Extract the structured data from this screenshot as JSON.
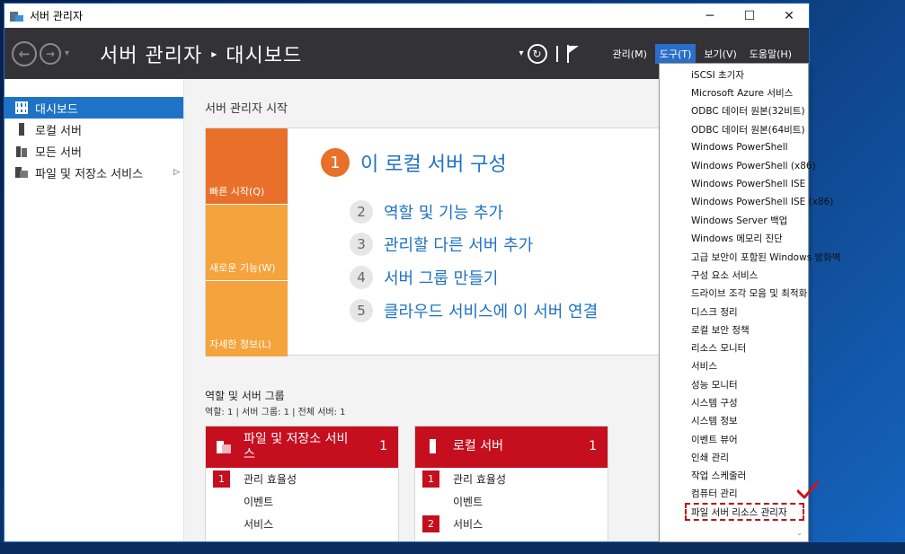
{
  "window": {
    "title": "서버 관리자",
    "controls": {
      "minimize": "─",
      "maximize": "☐",
      "close": "✕"
    }
  },
  "header": {
    "breadcrumb_root": "서버 관리자",
    "breadcrumb_sep": "▸",
    "breadcrumb_page": "대시보드",
    "refresh_drop": "▾",
    "menu": [
      "관리(M)",
      "도구(T)",
      "보기(V)",
      "도움말(H)"
    ],
    "active_menu": "도구(T)"
  },
  "sidebar": {
    "items": [
      {
        "label": "대시보드",
        "icon": "dashboard-icon",
        "selected": true
      },
      {
        "label": "로컬 서버",
        "icon": "server-icon"
      },
      {
        "label": "모든 서버",
        "icon": "servers-icon"
      },
      {
        "label": "파일 및 저장소 서비스",
        "icon": "file-storage-icon",
        "expand": "▷"
      }
    ]
  },
  "main": {
    "section_title": "서버 관리자 시작",
    "tiles": [
      "빠른 시작(Q)",
      "새로운 기능(W)",
      "자세한 정보(L)"
    ],
    "primary_step": {
      "num": "1",
      "label": "이 로컬 서버 구성"
    },
    "steps": [
      {
        "num": "2",
        "label": "역할 및 기능 추가"
      },
      {
        "num": "3",
        "label": "관리할 다른 서버 추가"
      },
      {
        "num": "4",
        "label": "서버 그룹 만들기"
      },
      {
        "num": "5",
        "label": "클라우드 서비스에 이 서버 연결"
      }
    ],
    "roles_title": "역할 및 서버 그룹",
    "roles_sub": "역할: 1  |  서버 그룹: 1  |  전체 서버: 1",
    "cards": [
      {
        "title": "파일 및 저장소 서비스",
        "count": "1",
        "rows": [
          {
            "badge": "1",
            "label": "관리 효율성"
          },
          {
            "badge": "",
            "label": "이벤트"
          },
          {
            "badge": "",
            "label": "서비스"
          }
        ]
      },
      {
        "title": "로컬 서버",
        "count": "1",
        "rows": [
          {
            "badge": "1",
            "label": "관리 효율성"
          },
          {
            "badge": "",
            "label": "이벤트"
          },
          {
            "badge": "2",
            "label": "서비스"
          }
        ]
      }
    ]
  },
  "tools_menu": {
    "items": [
      "iSCSI 초기자",
      "Microsoft Azure 서비스",
      "ODBC 데이터 원본(32비트)",
      "ODBC 데이터 원본(64비트)",
      "Windows PowerShell",
      "Windows PowerShell (x86)",
      "Windows PowerShell ISE",
      "Windows PowerShell ISE (x86)",
      "Windows Server 백업",
      "Windows 메모리 진단",
      "고급 보안이 포함된 Windows 방화벽",
      "구성 요소 서비스",
      "드라이브 조각 모음 및 최적화",
      "디스크 정리",
      "로컬 보안 정책",
      "리소스 모니터",
      "서비스",
      "성능 모니터",
      "시스템 구성",
      "시스템 정보",
      "이벤트 뷰어",
      "인쇄 관리",
      "작업 스케줄러",
      "컴퓨터 관리",
      "파일 서버 리소스 관리자"
    ],
    "highlighted": "파일 서버 리소스 관리자",
    "scroll_arrow": "⌄"
  },
  "colors": {
    "accent": "#1e73c6",
    "orange": "#e8702a",
    "tile_yellow": "#f5a33c",
    "card_red": "#c50f1f",
    "header_dark": "#333337"
  }
}
